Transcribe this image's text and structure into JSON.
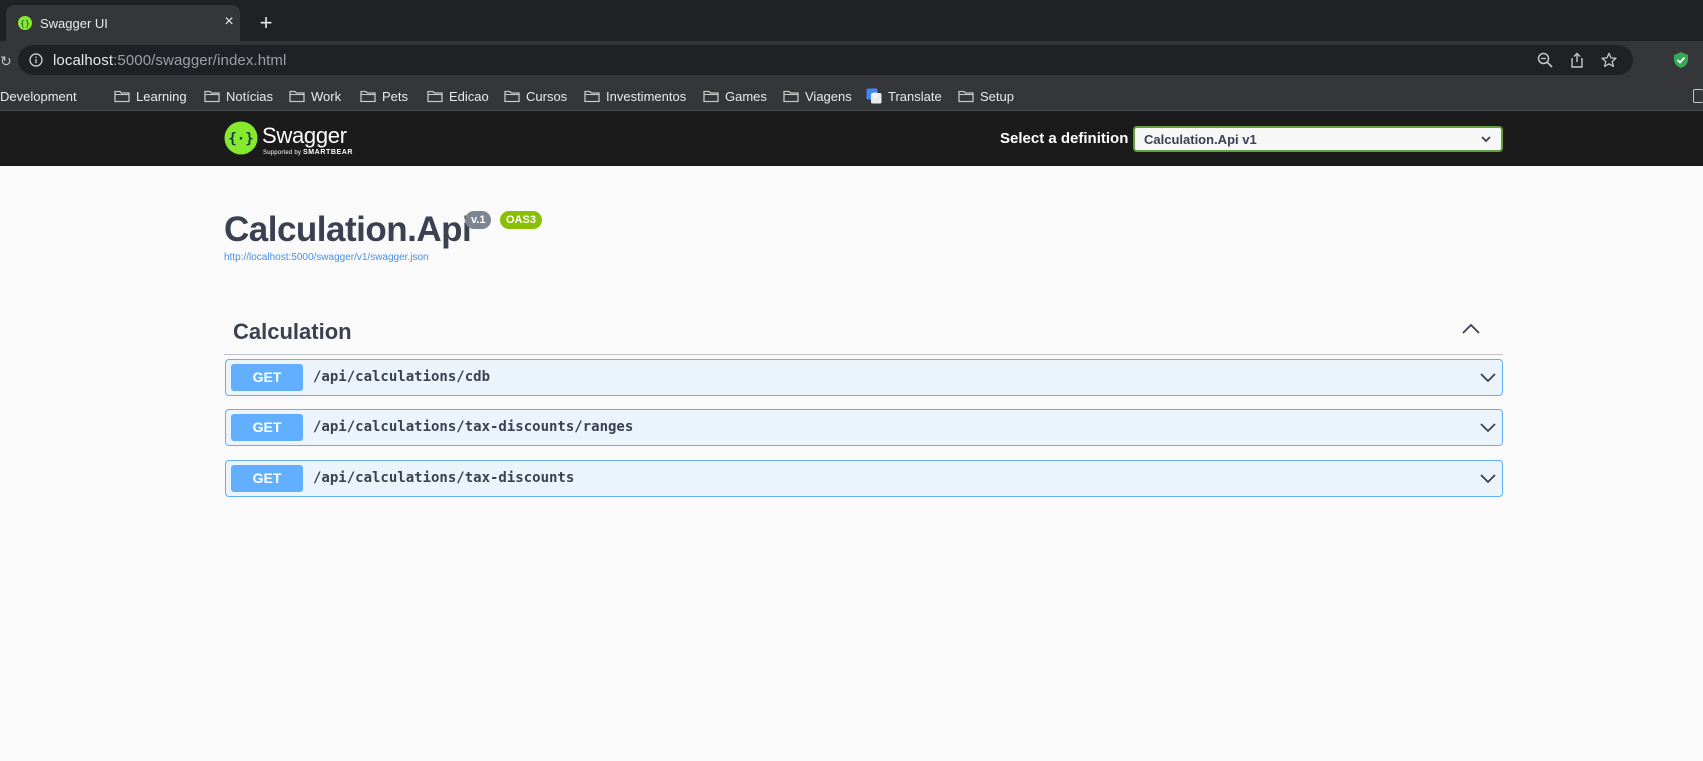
{
  "browser": {
    "tab_title": "Swagger UI",
    "tab_close": "×",
    "new_tab": "+",
    "url_host": "localhost",
    "url_rest": ":5000/swagger/index.html",
    "bookmarks": [
      {
        "label": "Development",
        "icon": "folder-icon"
      },
      {
        "label": "Learning",
        "icon": "folder-icon"
      },
      {
        "label": "Notícias",
        "icon": "folder-icon"
      },
      {
        "label": "Work",
        "icon": "folder-icon"
      },
      {
        "label": "Pets",
        "icon": "folder-icon"
      },
      {
        "label": "Edicao",
        "icon": "folder-icon"
      },
      {
        "label": "Cursos",
        "icon": "folder-icon"
      },
      {
        "label": "Investimentos",
        "icon": "folder-icon"
      },
      {
        "label": "Games",
        "icon": "folder-icon"
      },
      {
        "label": "Viagens",
        "icon": "folder-icon"
      },
      {
        "label": "Translate",
        "icon": "google-translate-icon"
      },
      {
        "label": "Setup",
        "icon": "folder-icon"
      }
    ]
  },
  "swagger": {
    "brand": "Swagger",
    "brand_sub_prefix": "Supported by ",
    "brand_sub_name": "SMARTBEAR",
    "definition_label": "Select a definition",
    "definition_value": "Calculation.Api v1"
  },
  "info": {
    "title": "Calculation.Api",
    "version": "v.1",
    "oas": "OAS3",
    "spec_url": "http://localhost:5000/swagger/v1/swagger.json"
  },
  "tag": {
    "name": "Calculation",
    "operations": [
      {
        "method": "GET",
        "path": "/api/calculations/cdb"
      },
      {
        "method": "GET",
        "path": "/api/calculations/tax-discounts/ranges"
      },
      {
        "method": "GET",
        "path": "/api/calculations/tax-discounts"
      }
    ]
  },
  "colors": {
    "get_accent": "#61affe",
    "get_bg": "#ebf3fb",
    "oas_badge": "#89bf04",
    "version_badge": "#7d8492",
    "swagger_green": "#85ea2d",
    "topbar_bg": "#1b1b1b"
  }
}
